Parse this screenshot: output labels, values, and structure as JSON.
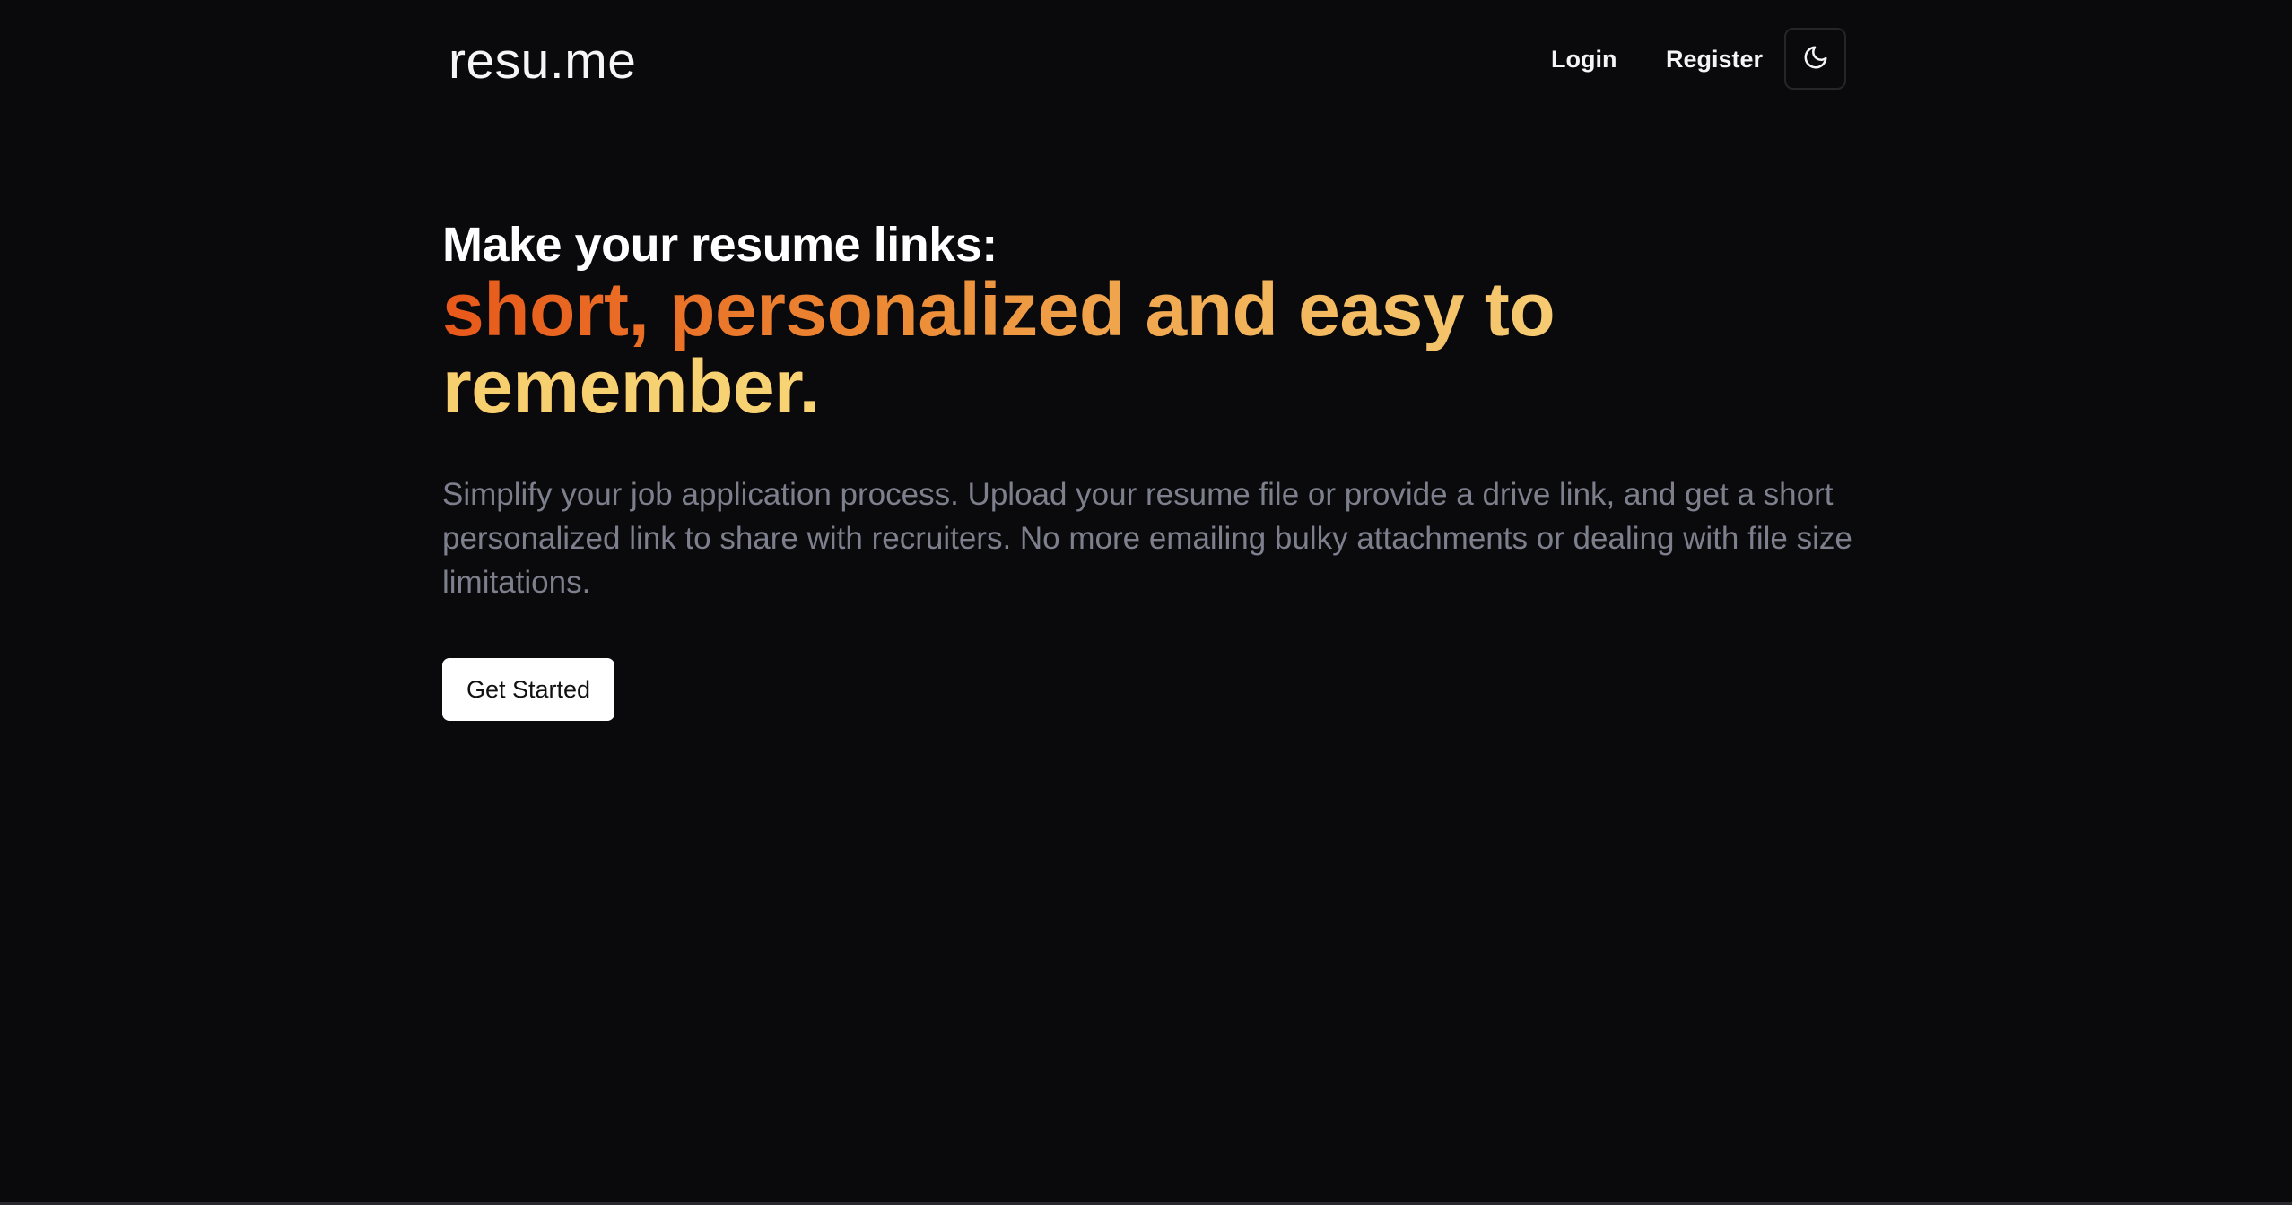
{
  "header": {
    "brand": "resu.me",
    "nav": {
      "login_label": "Login",
      "register_label": "Register"
    },
    "theme_toggle_icon": "moon-icon"
  },
  "hero": {
    "lead": "Make your resume links:",
    "highlight_line1": "short, personalized and easy to",
    "highlight_line2": "remember.",
    "highlight_gradient": [
      "#e8581a",
      "#ec8a35",
      "#f3b65c",
      "#f7d77e"
    ],
    "description": "Simplify your job application process. Upload your resume file or provide a drive link, and get a short personalized link to share with recruiters. No more emailing bulky attachments or dealing with file size limitations.",
    "cta_label": "Get Started"
  },
  "colors": {
    "background": "#0a0a0c",
    "text_primary": "#ffffff",
    "text_muted": "#7d7f8c"
  }
}
